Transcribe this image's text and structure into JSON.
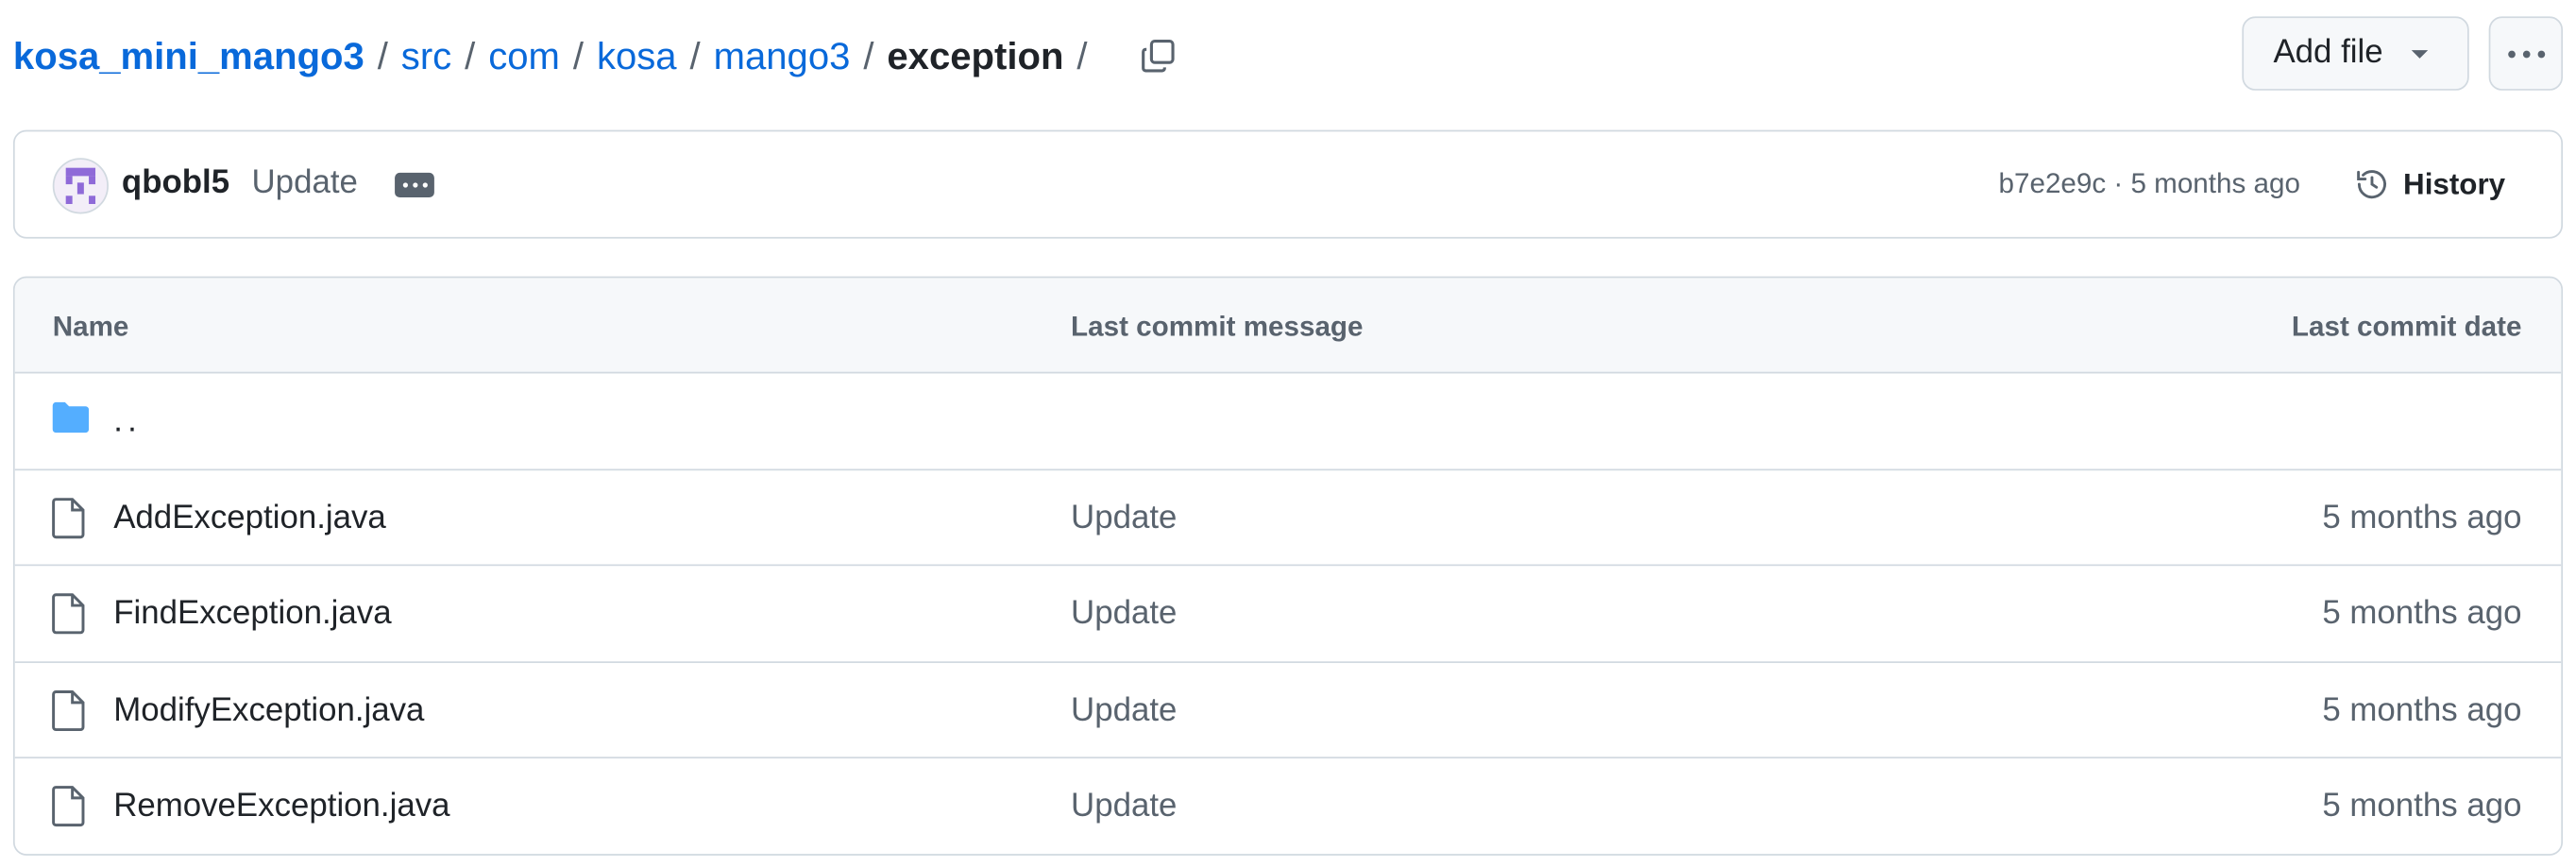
{
  "breadcrumb": {
    "repo": "kosa_mini_mango3",
    "parts": [
      "src",
      "com",
      "kosa",
      "mango3"
    ],
    "current": "exception",
    "separator": "/"
  },
  "actions": {
    "add_file_label": "Add file"
  },
  "commit": {
    "author": "qbobl5",
    "message": "Update",
    "sha_age": "b7e2e9c · 5 months ago",
    "history_label": "History"
  },
  "table": {
    "headers": {
      "name": "Name",
      "message": "Last commit message",
      "date": "Last commit date"
    },
    "parent": "..",
    "files": [
      {
        "name": "AddException.java",
        "message": "Update",
        "date": "5 months ago"
      },
      {
        "name": "FindException.java",
        "message": "Update",
        "date": "5 months ago"
      },
      {
        "name": "ModifyException.java",
        "message": "Update",
        "date": "5 months ago"
      },
      {
        "name": "RemoveException.java",
        "message": "Update",
        "date": "5 months ago"
      }
    ]
  },
  "colors": {
    "link": "#0969da",
    "muted": "#59636e",
    "folder": "#54aeff",
    "border": "#d1d9e0"
  }
}
